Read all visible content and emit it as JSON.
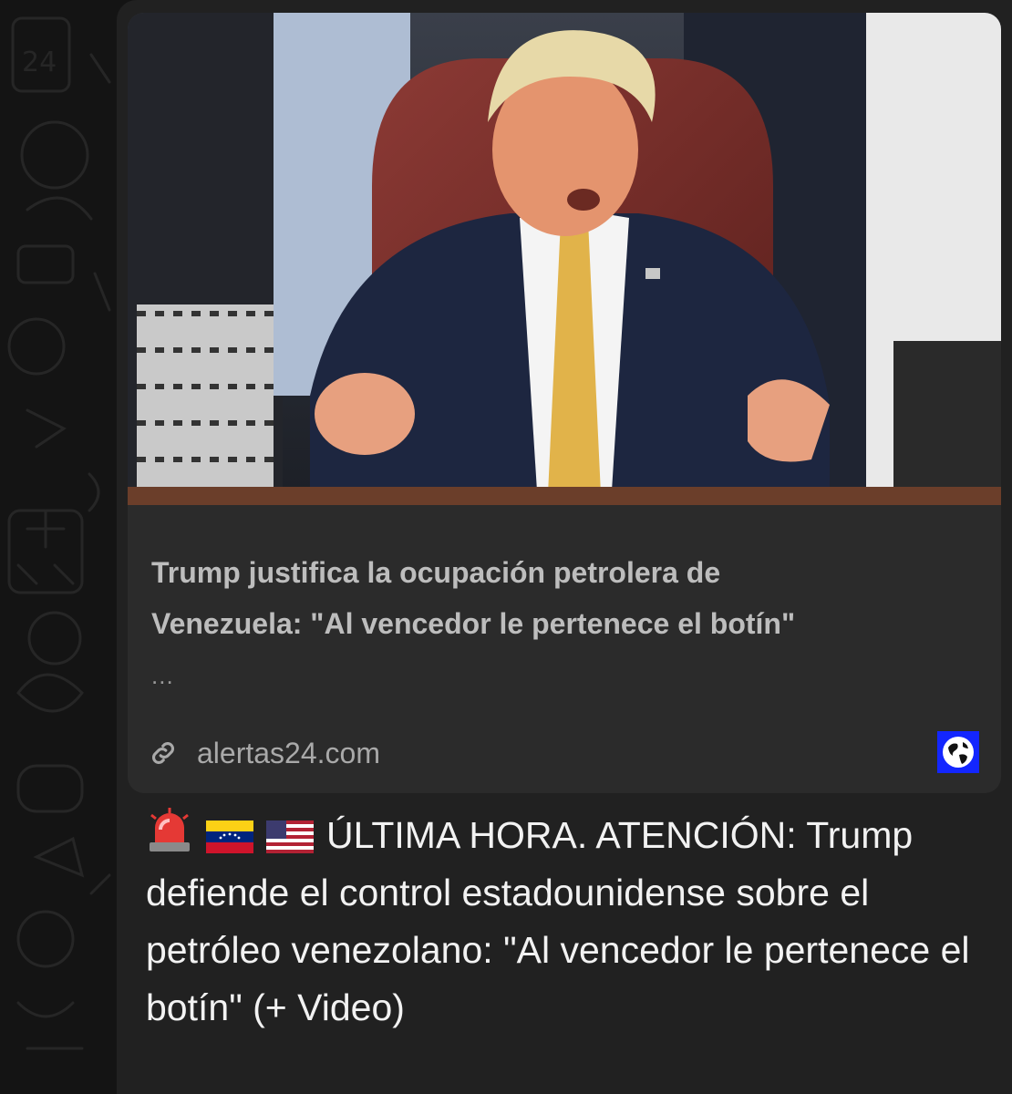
{
  "chat": {
    "link_preview": {
      "image_alt": "Man in dark suit and gold tie speaking at a desk, seated in a red leather chair with people standing behind",
      "title": "Trump justifica la ocupación petrolera de\nVenezuela: \"Al vencedor le pertenece el botín\"",
      "ellipsis": "...",
      "domain": "alertas24.com",
      "link_icon": "link-icon",
      "badge_icon": "globe-icon",
      "badge_color": "#1326ff"
    },
    "message": {
      "emojis": [
        "siren-emoji",
        "venezuela-flag-emoji",
        "usa-flag-emoji"
      ],
      "text": "ÚLTIMA HORA. ATENCIÓN: Trump defiende el control estadounidense sobre el petróleo venezolano: \"Al vencedor le pertenece el botín\" (+ Video)"
    }
  },
  "colors": {
    "background": "#141414",
    "bubble": "#212121",
    "card": "#2b2b2b",
    "text": "#f2f2f2",
    "muted_text": "#bdbdbd"
  }
}
